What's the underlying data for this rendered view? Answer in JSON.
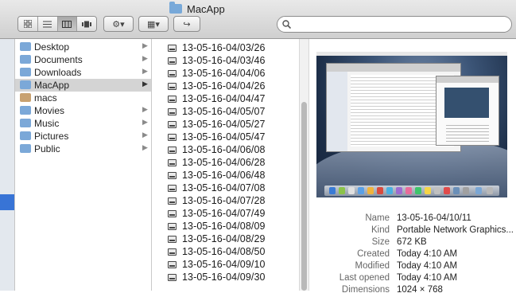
{
  "window": {
    "title": "MacApp"
  },
  "toolbar": {
    "view_buttons": [
      "icon-view-icon",
      "list-view-icon",
      "column-view-icon",
      "cover-flow-icon"
    ],
    "action_label": "⚙▾",
    "arrange_label": "▦▾",
    "share_label": "↪",
    "search": {
      "placeholder": ""
    }
  },
  "sidebar_column": {
    "items": [
      {
        "label": "Desktop",
        "icon": "folder-icon",
        "arrow": "▶"
      },
      {
        "label": "Documents",
        "icon": "folder-icon",
        "arrow": "▶"
      },
      {
        "label": "Downloads",
        "icon": "folder-icon",
        "arrow": "▶"
      },
      {
        "label": "MacApp",
        "icon": "folder-icon",
        "arrow": "▶",
        "selected": true
      },
      {
        "label": "macs",
        "icon": "home-icon",
        "arrow": ""
      },
      {
        "label": "Movies",
        "icon": "folder-icon",
        "arrow": "▶"
      },
      {
        "label": "Music",
        "icon": "folder-icon",
        "arrow": "▶"
      },
      {
        "label": "Pictures",
        "icon": "folder-icon",
        "arrow": "▶"
      },
      {
        "label": "Public",
        "icon": "folder-icon",
        "arrow": "▶"
      }
    ]
  },
  "file_column": {
    "files": [
      "13-05-16-04/03/26",
      "13-05-16-04/03/46",
      "13-05-16-04/04/06",
      "13-05-16-04/04/26",
      "13-05-16-04/04/47",
      "13-05-16-04/05/07",
      "13-05-16-04/05/27",
      "13-05-16-04/05/47",
      "13-05-16-04/06/08",
      "13-05-16-04/06/28",
      "13-05-16-04/06/48",
      "13-05-16-04/07/08",
      "13-05-16-04/07/28",
      "13-05-16-04/07/49",
      "13-05-16-04/08/09",
      "13-05-16-04/08/29",
      "13-05-16-04/08/50",
      "13-05-16-04/09/10",
      "13-05-16-04/09/30"
    ]
  },
  "preview": {
    "info": [
      {
        "key": "Name",
        "value": "13-05-16-04/10/11"
      },
      {
        "key": "Kind",
        "value": "Portable Network Graphics..."
      },
      {
        "key": "Size",
        "value": "672 KB"
      },
      {
        "key": "Created",
        "value": "Today 4:10 AM"
      },
      {
        "key": "Modified",
        "value": "Today 4:10 AM"
      },
      {
        "key": "Last opened",
        "value": "Today 4:10 AM"
      },
      {
        "key": "Dimensions",
        "value": "1024 × 768"
      }
    ]
  },
  "colors": {
    "selection_gray": "#d4d4d4",
    "accent_blue": "#3874d6",
    "folder_blue": "#7ba8d8"
  }
}
